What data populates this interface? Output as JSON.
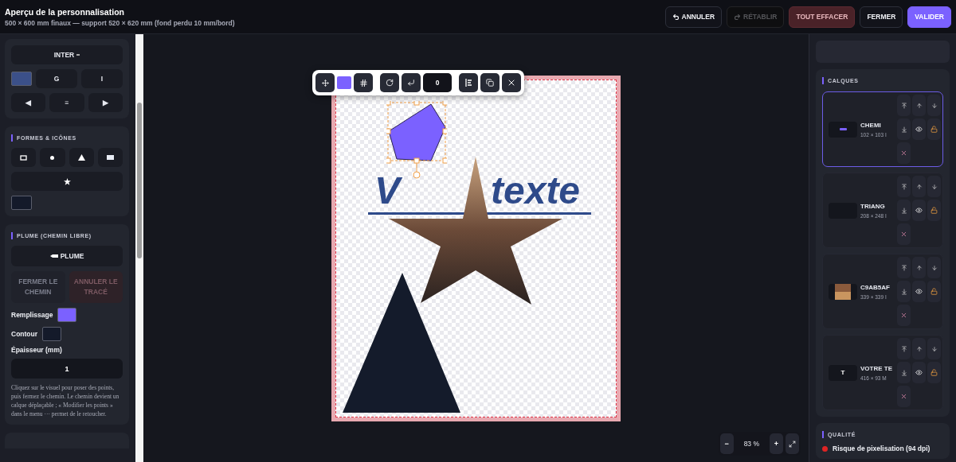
{
  "header": {
    "title": "Aperçu de la personnalisation",
    "subtitle": "500 × 600 mm finaux — support 520 × 620 mm (fond perdu 10 mm/bord)",
    "buttons": [
      {
        "kind": "undo",
        "label": "ANNULER",
        "disabled": false
      },
      {
        "kind": "redo",
        "label": "RÉTABLIR",
        "disabled": true
      },
      {
        "kind": "danger",
        "label": "TOUT EFFACER",
        "disabled": false
      },
      {
        "kind": "plain",
        "label": "FERMER",
        "disabled": false
      },
      {
        "kind": "primary",
        "label": "VALIDER",
        "disabled": false
      }
    ]
  },
  "text_panel": {
    "font": "INTER",
    "color": "#3b5089",
    "style_buttons": [
      "G",
      "I"
    ],
    "align_buttons": [
      {
        "label": "◀",
        "selected": false
      },
      {
        "label": "≡",
        "selected": false
      },
      {
        "label": "▶",
        "selected": false
      }
    ]
  },
  "shapes_panel": {
    "title": "FORMES & ICÔNES",
    "shapes": [
      {
        "kind": "rect-outline"
      },
      {
        "kind": "dot"
      },
      {
        "kind": "triangle"
      },
      {
        "kind": "rect"
      },
      {
        "kind": "star"
      }
    ],
    "color": "#141a2a"
  },
  "pen_panel": {
    "title": "PLUME (CHEMIN LIBRE)",
    "pen_button": "PLUME",
    "close_button": {
      "label": "FERMER LE CHEMIN",
      "disabled": true
    },
    "cancel_button": {
      "label": "ANNULER LE TRACÉ",
      "disabled": true
    },
    "swatches": [
      {
        "label": "Remplissage",
        "color": "#7b61ff"
      },
      {
        "label": "Contour",
        "color": "#141a2a"
      }
    ],
    "width_label": "Épaisseur (mm)",
    "width_value": "1",
    "help": "Cliquez sur le visuel pour poser des points, puis fermez le chemin. Le chemin devient un calque déplaçable ; « Modifier les points » dans le menu ··· permet de le retoucher."
  },
  "toolbar": {
    "color": "#7b61ff",
    "rotation": "0"
  },
  "artboard": {
    "text_parts": [
      "V",
      "texte"
    ]
  },
  "zoom": {
    "minus": "−",
    "value": "83 %",
    "plus": "+"
  },
  "layers": {
    "title": "CALQUES",
    "items": [
      {
        "kind": "path",
        "name": "CHEMI",
        "size": "102 × 103 I",
        "selected": true,
        "visible": true,
        "locked": false
      },
      {
        "kind": "shape",
        "name": "TRIANG",
        "size": "208 × 248 I",
        "selected": false,
        "visible": true,
        "locked": false
      },
      {
        "kind": "image",
        "name": "C9AB5AF",
        "size": "339 × 339 I",
        "selected": false,
        "visible": true,
        "locked": false
      },
      {
        "kind": "text",
        "thumb_text": "T",
        "name": "VOTRE TE",
        "size": "416 × 93 M",
        "selected": false,
        "visible": true,
        "locked": false
      }
    ]
  },
  "quality": {
    "title": "QUALITÉ",
    "message": "Risque de pixelisation (94 dpi)",
    "color": "#e02424"
  }
}
